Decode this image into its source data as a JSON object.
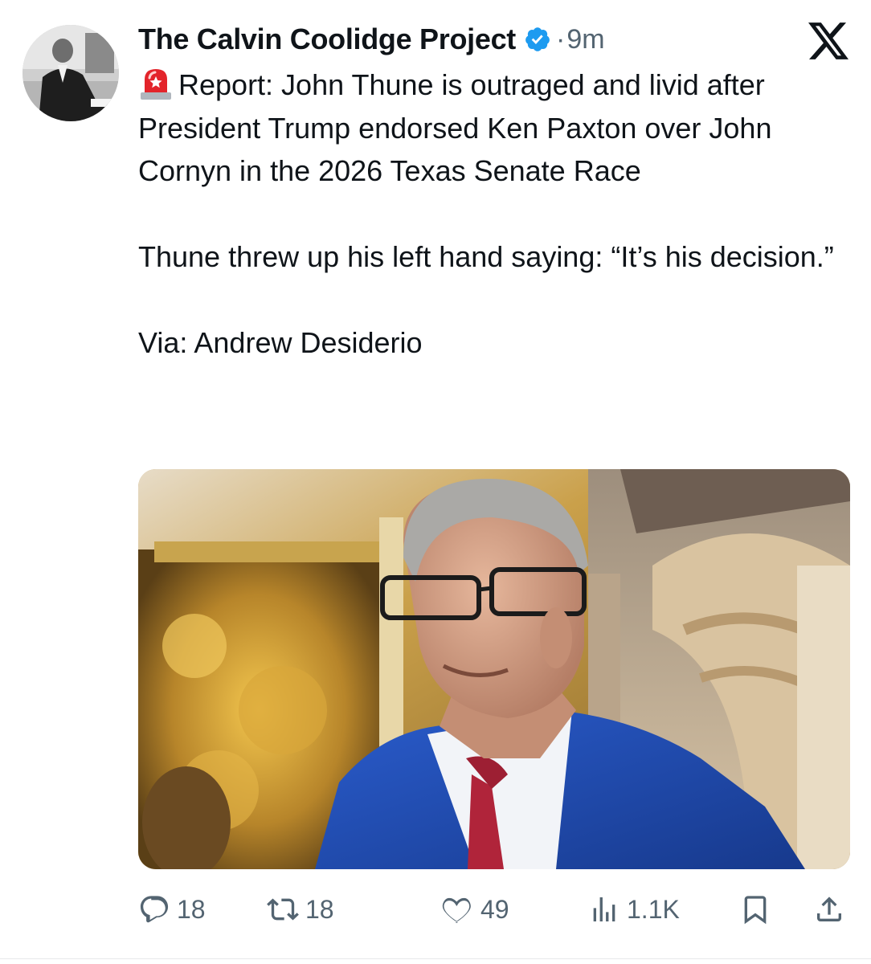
{
  "author": {
    "display_name": "The Calvin Coolidge Project",
    "verified": true,
    "separator": "·",
    "time_ago": "9m",
    "avatar_icon": "avatar-photo"
  },
  "platform_icon": "x-logo-icon",
  "body": {
    "emoji_icon": "police-siren-icon",
    "paragraph_1": "Report: John Thune is outraged and livid after President Trump endorsed Ken Paxton over John Cornyn in the 2026 Texas Senate Race",
    "paragraph_2": "Thune threw up his left hand saying: “It’s his decision.”",
    "paragraph_3": "Via: Andrew Desiderio"
  },
  "media": {
    "type": "photo"
  },
  "actions": {
    "reply_count": "18",
    "retweet_count": "18",
    "like_count": "49",
    "views_count": "1.1K"
  },
  "colors": {
    "text": "#0f1419",
    "secondary": "#536471",
    "verified": "#1d9bf0",
    "suit_blue": "#1f4fb8"
  }
}
